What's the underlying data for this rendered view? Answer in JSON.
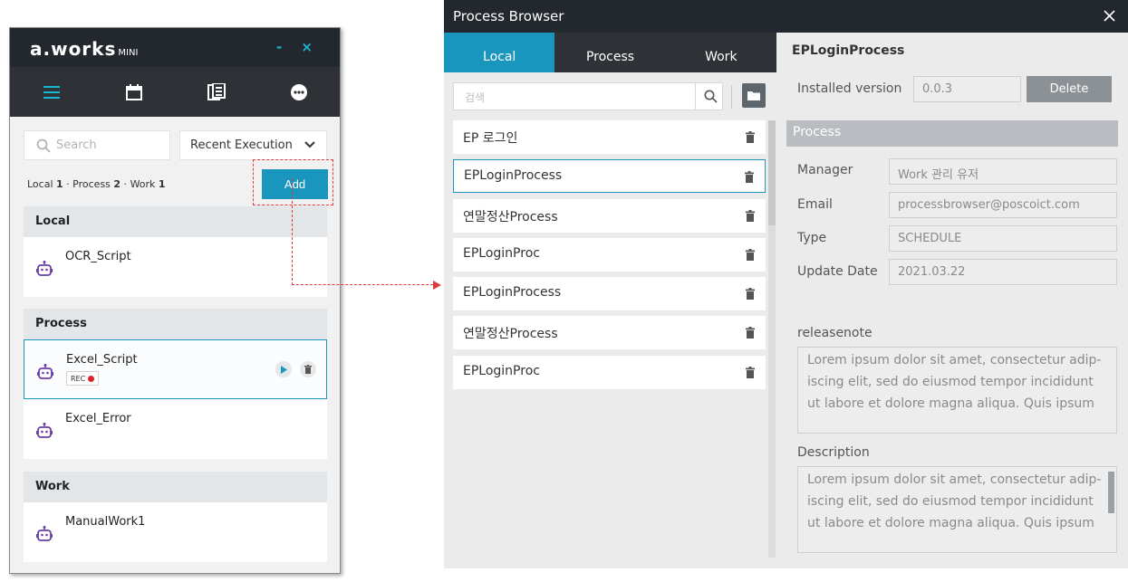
{
  "mini": {
    "logo": "a.works",
    "logo_suffix": "MINI",
    "window_controls": "- ×",
    "nav": [
      {
        "icon": "menu-icon"
      },
      {
        "icon": "calendar-icon"
      },
      {
        "icon": "script-list-icon"
      },
      {
        "icon": "more-icon"
      }
    ],
    "search_placeholder": "Search",
    "sort_label": "Recent Execution",
    "counts": {
      "local_label": "Local",
      "local": "1",
      "process_label": "Process",
      "process": "2",
      "work_label": "Work",
      "work": "1"
    },
    "add_label": "Add",
    "sections": [
      {
        "title": "Local",
        "items": [
          {
            "name": "OCR_Script"
          }
        ]
      },
      {
        "title": "Process",
        "items": [
          {
            "name": "Excel_Script",
            "badge": "REC"
          },
          {
            "name": "Excel_Error"
          }
        ]
      },
      {
        "title": "Work",
        "items": [
          {
            "name": "ManualWork1"
          }
        ]
      }
    ],
    "colors": {
      "accent": "#1a95bd",
      "titlebar": "#22282d",
      "rec": "#e0232a",
      "robot": "#6a3fa6"
    }
  },
  "browser": {
    "title": "Process Browser",
    "tabs": [
      {
        "label": "Local",
        "active": true
      },
      {
        "label": "Process",
        "active": false
      },
      {
        "label": "Work",
        "active": false
      }
    ],
    "search_placeholder": "검색",
    "items": [
      {
        "name": "EP 로그인"
      },
      {
        "name": "EPLoginProcess",
        "selected": true
      },
      {
        "name": "연말정산Process"
      },
      {
        "name": "EPLoginProc"
      },
      {
        "name": "EPLoginProcess"
      },
      {
        "name": "연말정산Process"
      },
      {
        "name": "EPLoginProc"
      }
    ],
    "detail": {
      "title": "EPLoginProcess",
      "installed_version_label": "Installed version",
      "installed_version": "0.0.3",
      "delete_label": "Delete",
      "section_label": "Process",
      "manager_label": "Manager",
      "manager": "Work 관리 유저",
      "email_label": "Email",
      "email": "processbrowser@poscoict.com",
      "type_label": "Type",
      "type": "SCHEDULE",
      "update_label": "Update Date",
      "update": "2021.03.22",
      "releasenote_label": "releasenote",
      "releasenote_lines": [
        "Lorem ipsum dolor sit amet, consectetur adip-",
        "iscing elit, sed do eiusmod tempor incididunt",
        "ut labore et dolore magna aliqua. Quis ipsum"
      ],
      "description_label": "Description",
      "description_lines": [
        "Lorem ipsum dolor sit amet, consectetur adip-",
        "iscing elit, sed do eiusmod tempor incididunt",
        "ut labore et dolore magna aliqua. Quis ipsum"
      ]
    }
  }
}
